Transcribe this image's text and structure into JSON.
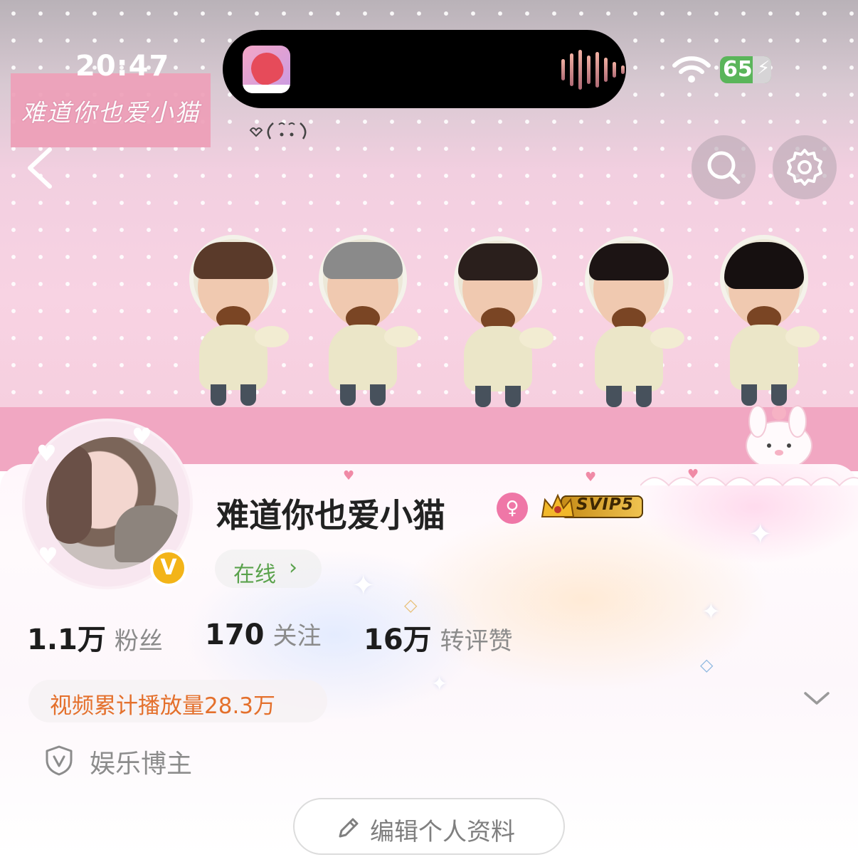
{
  "status_bar": {
    "time": "20:47",
    "battery_level": "65"
  },
  "banner": {
    "sign_text": "难道你也爱小猫"
  },
  "profile": {
    "name": "难道你也爱小猫",
    "verified_badge": "V",
    "gender_symbol": "♀",
    "vip_badge": "SVIP5",
    "online_status": "在线",
    "stats": [
      {
        "value": "1.1万",
        "label": "粉丝"
      },
      {
        "value": "170",
        "label": "关注"
      },
      {
        "value": "16万",
        "label": "转评赞"
      }
    ],
    "video_views": "视频累计播放量28.3万",
    "tag": "娱乐博主",
    "edit_button": "编辑个人资料"
  },
  "colors": {
    "accent_orange": "#e4702c",
    "online_green": "#5aa24c",
    "banner_pink": "#f1a7c2",
    "verified_gold": "#f3b418"
  },
  "icons": [
    "back-arrow-icon",
    "search-icon",
    "gear-icon",
    "wifi-icon",
    "battery-icon",
    "chevron-right-icon",
    "chevron-down-icon",
    "shield-v-icon",
    "pencil-icon"
  ]
}
